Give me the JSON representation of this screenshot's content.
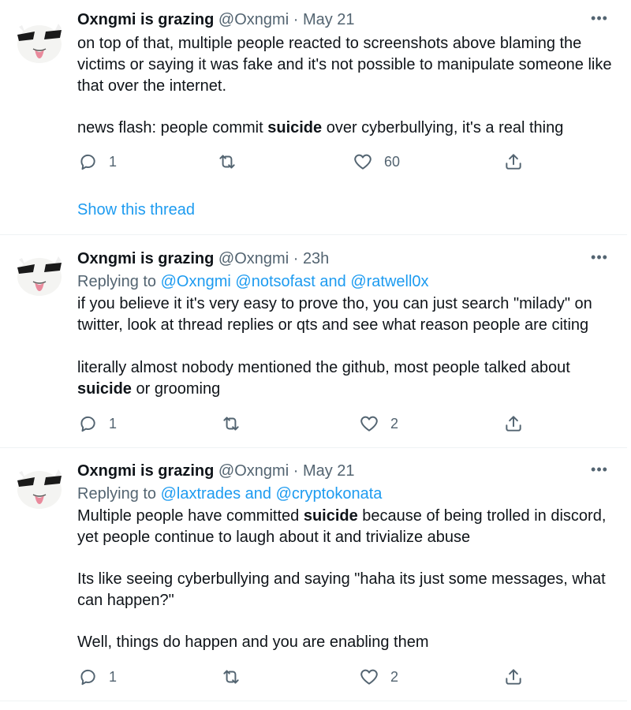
{
  "icons": {
    "reply": "reply-icon",
    "retweet": "retweet-icon",
    "like": "heart-icon",
    "share": "share-icon",
    "more": "more-icon"
  },
  "colors": {
    "link": "#1d9bf0",
    "muted": "#536471",
    "text": "#0f1419"
  },
  "tweets": [
    {
      "name": "Oxngmi is grazing",
      "handle": "@Oxngmi",
      "sep": "·",
      "time": "May 21",
      "paragraphs": [
        {
          "pre": "on top of that, multiple people reacted to screenshots above blaming the victims or saying it was fake and it's not possible to manipulate someone like that over the internet.",
          "bold": "",
          "post": ""
        },
        {
          "pre": "news flash: people commit ",
          "bold": "suicide",
          "post": " over cyberbullying, it's a real thing"
        }
      ],
      "replies": "1",
      "retweets": "",
      "likes": "60",
      "show_thread": "Show this thread"
    },
    {
      "name": "Oxngmi is grazing",
      "handle": "@Oxngmi",
      "sep": "·",
      "time": "23h",
      "replying_prefix": "Replying to",
      "replying_to": "@Oxngmi @notsofast and @ratwell0x",
      "paragraphs": [
        {
          "pre": "if you believe it it's very easy to prove tho, you can just search \"milady\" on twitter, look at thread replies or qts and see what reason people are citing",
          "bold": "",
          "post": ""
        },
        {
          "pre": "literally almost nobody mentioned the github, most people talked about ",
          "bold": "suicide",
          "post": " or grooming"
        }
      ],
      "replies": "1",
      "retweets": "",
      "likes": "2"
    },
    {
      "name": "Oxngmi is grazing",
      "handle": "@Oxngmi",
      "sep": "·",
      "time": "May 21",
      "replying_prefix": "Replying to",
      "replying_to": "@laxtrades and @cryptokonata",
      "paragraphs": [
        {
          "pre": "Multiple people have committed ",
          "bold": "suicide",
          "post": " because of being trolled in discord, yet people continue to laugh about it and trivialize abuse"
        },
        {
          "pre": "Its like seeing cyberbullying and saying \"haha its just some messages, what can happen?\"",
          "bold": "",
          "post": ""
        },
        {
          "pre": "Well, things do happen and you are enabling them",
          "bold": "",
          "post": ""
        }
      ],
      "replies": "1",
      "retweets": "",
      "likes": "2"
    }
  ]
}
